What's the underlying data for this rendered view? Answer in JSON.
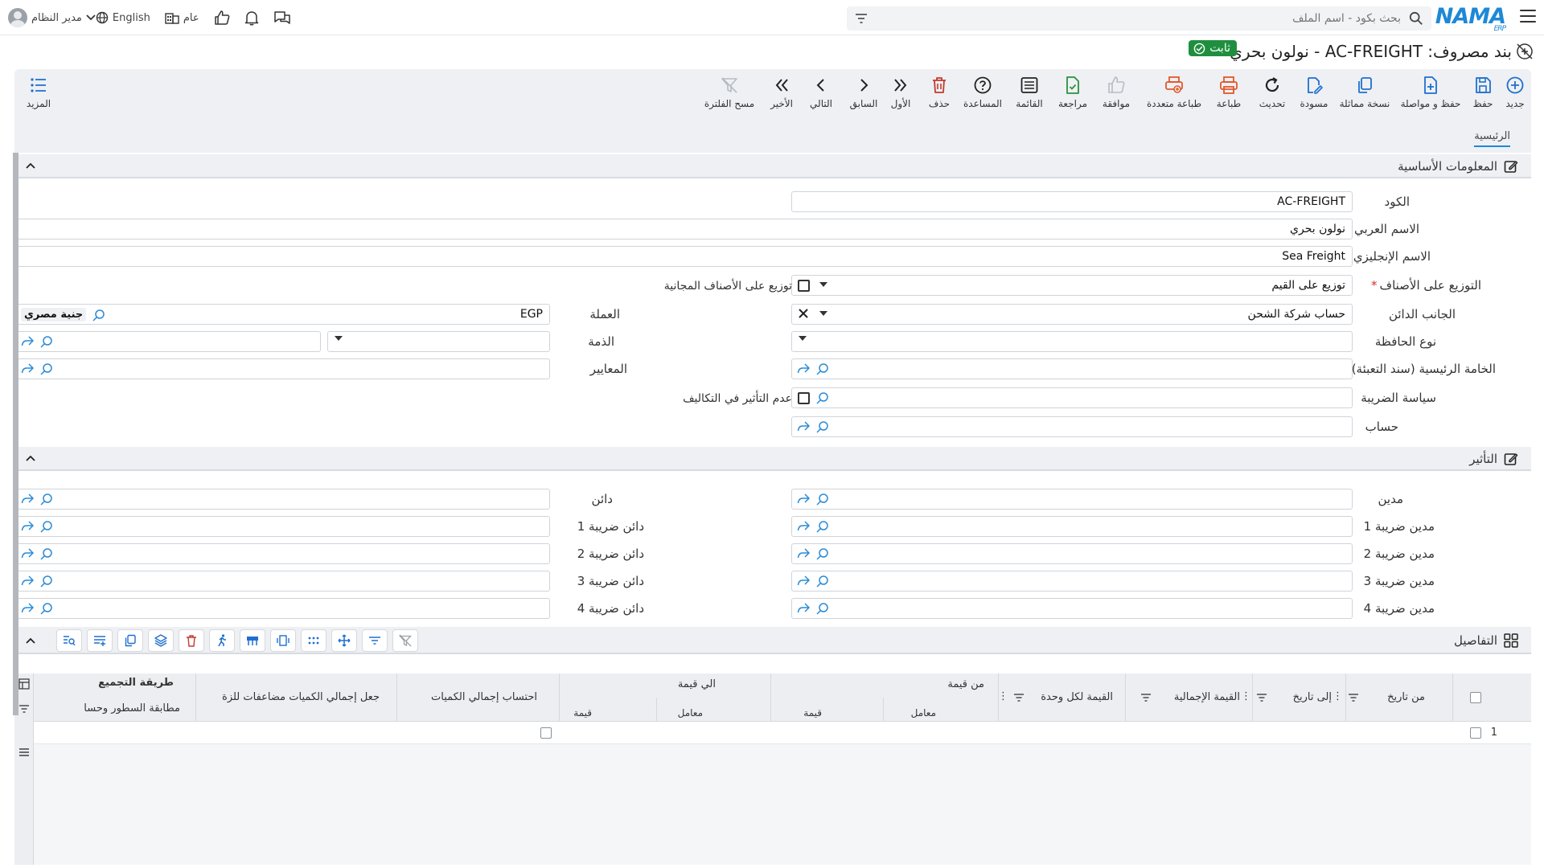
{
  "topbar": {
    "logo": "NAMA",
    "logo_sub": "ERP",
    "search_placeholder": "بحث بكود - اسم الملف",
    "user_name": "مدير النظام",
    "language": "English",
    "scope": "عام"
  },
  "title": {
    "text": "بند مصروف: AC-FREIGHT - نولون بحري",
    "status": "ثابت"
  },
  "toolbar": {
    "new": "جديد",
    "save": "حفظ",
    "save_continue": "حفظ و مواصلة",
    "copy": "نسخة مماثلة",
    "draft": "مسودة",
    "refresh": "تحديث",
    "print": "طباعة",
    "multi_print": "طباعة متعددة",
    "approve": "موافقة",
    "review": "مراجعة",
    "list": "القائمة",
    "help": "المساعدة",
    "delete": "حذف",
    "first": "الأول",
    "previous": "السابق",
    "next": "التالي",
    "last": "الأخير",
    "clear_filter": "مسح الفلترة",
    "more": "المزيد"
  },
  "tabs": {
    "main": "الرئيسية"
  },
  "basic": {
    "title": "المعلومات الأساسية",
    "code_label": "الكود",
    "code_value": "AC-FREIGHT",
    "arabic_name_label": "الاسم العربي",
    "arabic_name_value": "نولون بحري",
    "english_name_label": "الاسم الإنجليزي",
    "english_name_value": "Sea Freight",
    "distribution_label": "التوزيع على الأصناف",
    "distribution_value": "توزيع على القيم",
    "free_items_label": "توزيع على الأصناف المجانية",
    "creditor_label": "الجانب الدائن",
    "creditor_value": "حساب شركة الشحن",
    "currency_label": "العملة",
    "currency_code": "EGP",
    "currency_name": "جنية مصري",
    "wallet_type_label": "نوع الحافظة",
    "liability_label": "الذمة",
    "main_material_label": "الخامة الرئيسية (سند التعبئة)",
    "criteria_label": "المعايير",
    "tax_policy_label": "سياسة الضريبة",
    "no_cost_effect_label": "عدم التأثير في التكاليف",
    "account_label": "حساب"
  },
  "effect": {
    "title": "التأثير",
    "debit": "مدين",
    "credit": "دائن",
    "debit_tax_1": "مدين ضريبة 1",
    "credit_tax_1": "دائن ضريبة 1",
    "debit_tax_2": "مدين ضريبة 2",
    "credit_tax_2": "دائن ضريبة 2",
    "debit_tax_3": "مدين ضريبة 3",
    "credit_tax_3": "دائن ضريبة 3",
    "debit_tax_4": "مدين ضريبة 4",
    "credit_tax_4": "دائن ضريبة 4"
  },
  "details": {
    "title": "التفاصيل",
    "columns": {
      "from_date": "من تاريخ",
      "to_date": "إلى تاريخ",
      "total_value": "القيمة الإجمالية",
      "unit_value": "القيمة لكل وحدة",
      "from_value": "من قيمة",
      "to_value": "الي قيمة",
      "factor": "معامل",
      "value": "قيمة",
      "calc_total_qty": "احتساب إجمالي الكميات",
      "make_total_qty": "جعل إجمالي الكميات مضاعفات للزة",
      "aggregation": "طريقة التجميع",
      "match_lines": "مطابقة السطور وحسا"
    },
    "row_number": "1"
  }
}
